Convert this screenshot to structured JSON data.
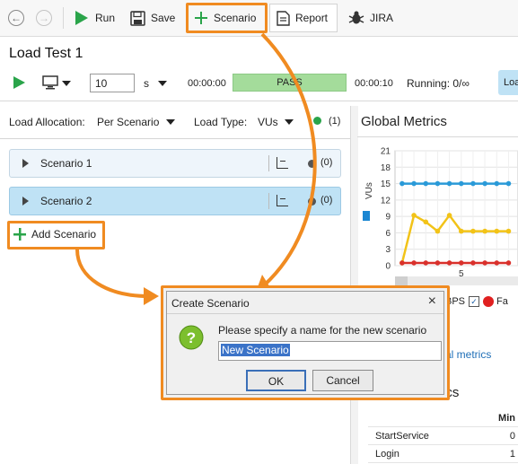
{
  "toolbar": {
    "back_icon": "arrow-left-icon",
    "forward_icon": "arrow-right-icon",
    "run_label": "Run",
    "save_label": "Save",
    "scenario_label": "Scenario",
    "report_label": "Report",
    "jira_label": "JIRA"
  },
  "test": {
    "title": "Load Test 1",
    "duration_value": "10",
    "duration_unit": "s",
    "elapsed": "00:00:00",
    "status": "PASS",
    "remaining": "00:00:10",
    "running": "Running: 0/∞",
    "right_tab": "Loa"
  },
  "allocation": {
    "label": "Load Allocation:",
    "value": "Per Scenario",
    "type_label": "Load Type:",
    "type_value": "VUs",
    "count": "(1)"
  },
  "scenarios": [
    {
      "name": "Scenario 1",
      "count": "(0)"
    },
    {
      "name": "Scenario 2",
      "count": "(0)"
    }
  ],
  "add_scenario_label": "Add Scenario",
  "global_metrics": {
    "title": "Global Metrics",
    "legend_bps": "BPS",
    "legend_fa": "Fa",
    "link": "al metrics"
  },
  "metrics": {
    "title": "rics",
    "col_min": "Min",
    "rows": [
      {
        "name": "StartService",
        "min": "0"
      },
      {
        "name": "Login",
        "min": "1"
      }
    ]
  },
  "chart_data": {
    "type": "line",
    "ylabel": "VUs",
    "yticks": [
      0,
      3,
      6,
      9,
      12,
      15,
      18,
      21
    ],
    "xticks": [
      5
    ],
    "ylim": [
      0,
      21
    ],
    "x": [
      0,
      1,
      2,
      3,
      4,
      5,
      6,
      7,
      8,
      9
    ],
    "series": [
      {
        "color": "#2a9ad8",
        "values": [
          15,
          15,
          15,
          15,
          15,
          15,
          15,
          15,
          15,
          15
        ]
      },
      {
        "color": "#f2c318",
        "values": [
          0.5,
          9.2,
          8,
          6.3,
          9.2,
          6.3,
          6.3,
          6.3,
          6.3,
          6.3
        ]
      },
      {
        "color": "#d9302b",
        "values": [
          0.5,
          0.5,
          0.5,
          0.5,
          0.5,
          0.5,
          0.5,
          0.5,
          0.5,
          0.5
        ]
      }
    ]
  },
  "dialog": {
    "title": "Create Scenario",
    "message": "Please specify a name for the new scenario",
    "input_value": "New Scenario",
    "ok_label": "OK",
    "cancel_label": "Cancel"
  },
  "colors": {
    "accent": "#f08b21",
    "run_green": "#2aa44a",
    "pass_bg": "#a4dc9b",
    "scenario_bg": "#eef5fb",
    "scenario_selected_bg": "#bfe2f5"
  }
}
